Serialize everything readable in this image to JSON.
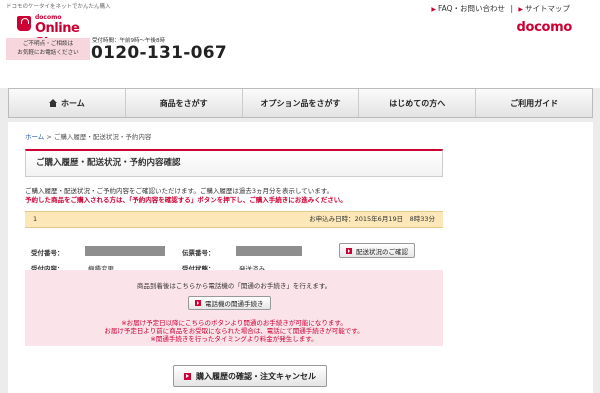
{
  "header": {
    "tagline": "ドコモのケータイをネットでかんたん購入",
    "logo_small": "docomo",
    "logo_big": "Online Shop",
    "links": [
      "FAQ・お問い合わせ",
      "サイトマップ"
    ],
    "brand": "docomo",
    "consult_line1": "ご不明点・ご相談は",
    "consult_line2": "お気軽にお電話ください",
    "hours": "受付時間：午前9時〜午後8時",
    "phone": "0120-131-067"
  },
  "nav": {
    "items": [
      "ホーム",
      "商品をさがす",
      "オプション品をさがす",
      "はじめての方へ",
      "ご利用ガイド"
    ]
  },
  "breadcrumb": {
    "home": "ホーム",
    "sep": ">",
    "current": "ご購入履歴・配送状況・予約内容"
  },
  "page": {
    "title": "ご購入履歴・配送状況・予約内容確認",
    "intro": "ご購入履歴・配送状況・ご予約内容をご確認いただけます。ご購入履歴は過去3ヵ月分を表示しています。",
    "notice": "予約した商品をご購入される方は、「予約内容を確認する」ボタンを押下し、ご購入手続きにお進みください。"
  },
  "order": {
    "number": "1",
    "date": "お申込み日時：2015年6月19日　8時33分",
    "reception_label": "受付番号：",
    "slip_label": "伝票番号：",
    "content_label": "受付内容：",
    "content_value": "機種変更",
    "status_label": "受付状態：",
    "status_value": "発送済み",
    "delivery_button": "配送状況のご確認"
  },
  "panel": {
    "line1": "商品到着後はこちらから電話機の「開通のお手続き」を行えます。",
    "activate_button": "電話機の開通手続き",
    "red1": "※お届け予定日以降にこちらのボタンより開通のお手続きが可能になります。",
    "red2": "お届け予定日より前に商品をお受取になられた場合は、電話にて開通手続きが可能です。",
    "red3": "※開通手続きを行ったタイミングより料金が発生します。"
  },
  "footer_button": "購入履歴の確認・注文キャンセル",
  "colors": {
    "accent": "#cc0033",
    "order_bar": "#fbe7b7",
    "panel": "#fbe3ea"
  }
}
